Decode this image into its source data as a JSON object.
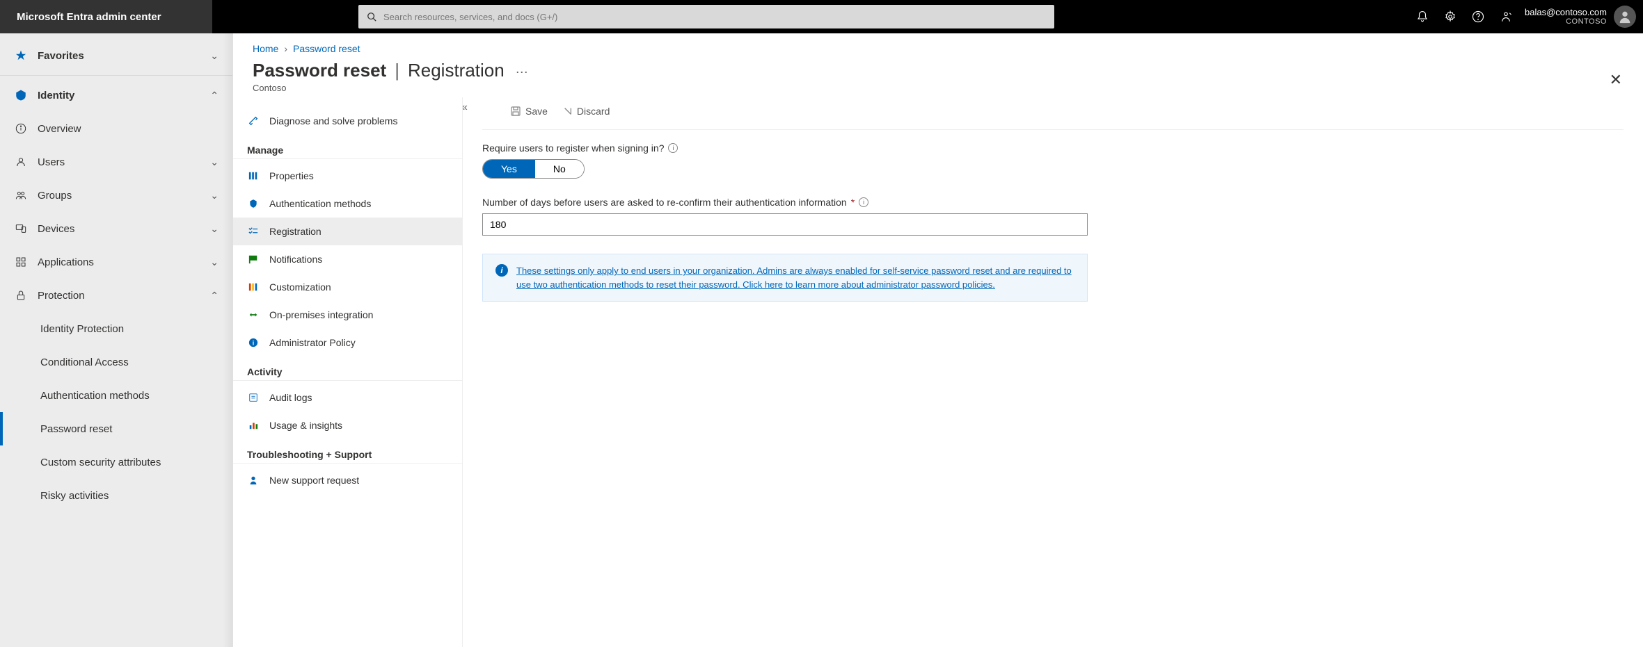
{
  "header": {
    "brand": "Microsoft Entra admin center",
    "search_placeholder": "Search resources, services, and docs (G+/)",
    "account_email": "balas@contoso.com",
    "account_tenant": "CONTOSO"
  },
  "sidebar": {
    "favorites": "Favorites",
    "identity": "Identity",
    "items": {
      "overview": "Overview",
      "users": "Users",
      "groups": "Groups",
      "devices": "Devices",
      "applications": "Applications",
      "protection": "Protection"
    },
    "protection_children": {
      "identity_protection": "Identity Protection",
      "conditional_access": "Conditional Access",
      "auth_methods": "Authentication methods",
      "password_reset": "Password reset",
      "custom_sec": "Custom security attributes",
      "risky": "Risky activities"
    }
  },
  "blade": {
    "diagnose": "Diagnose and solve problems",
    "sections": {
      "manage": "Manage",
      "activity": "Activity",
      "troubleshoot": "Troubleshooting + Support"
    },
    "manage_items": {
      "properties": "Properties",
      "auth_methods": "Authentication methods",
      "registration": "Registration",
      "notifications": "Notifications",
      "customization": "Customization",
      "onprem": "On-premises integration",
      "admin_policy": "Administrator Policy"
    },
    "activity_items": {
      "audit": "Audit logs",
      "usage": "Usage & insights"
    },
    "support_items": {
      "new_request": "New support request"
    }
  },
  "main": {
    "crumb_home": "Home",
    "crumb_current": "Password reset",
    "title_main": "Password reset",
    "title_sub": "Registration",
    "org": "Contoso",
    "cmd_save": "Save",
    "cmd_discard": "Discard",
    "q1_label": "Require users to register when signing in?",
    "q1_yes": "Yes",
    "q1_no": "No",
    "q2_label": "Number of days before users are asked to re-confirm their authentication information",
    "q2_value": "180",
    "banner_text": "These settings only apply to end users in your organization. Admins are always enabled for self-service password reset and are required to use two authentication methods to reset their password. Click here to learn more about administrator password policies."
  }
}
